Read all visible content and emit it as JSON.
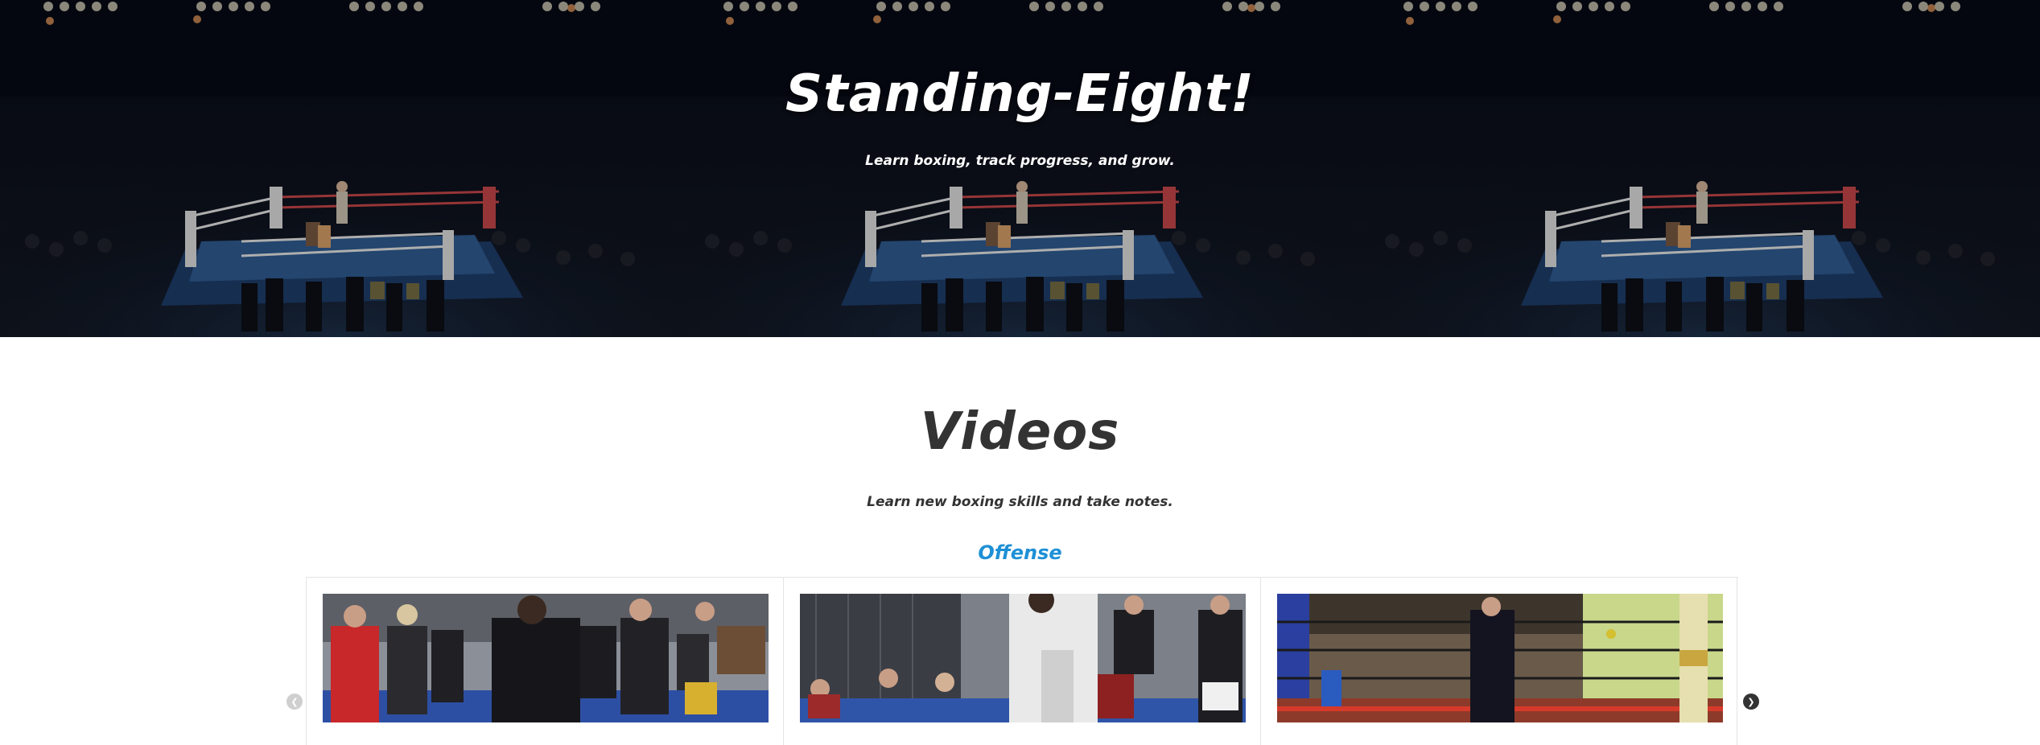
{
  "hero": {
    "title": "Standing-Eight!",
    "subtitle": "Learn boxing, track progress, and grow."
  },
  "videos": {
    "title": "Videos",
    "subtitle": "Learn new boxing skills and take notes.",
    "category": "Offense",
    "carousel": {
      "prev_icon": "chevron-left-icon",
      "next_icon": "chevron-right-icon",
      "prev_disabled": true
    }
  },
  "colors": {
    "hero_bg": "#060a14",
    "heading": "#333333",
    "category": "#1e90d6",
    "divider": "#e4e4e4"
  }
}
